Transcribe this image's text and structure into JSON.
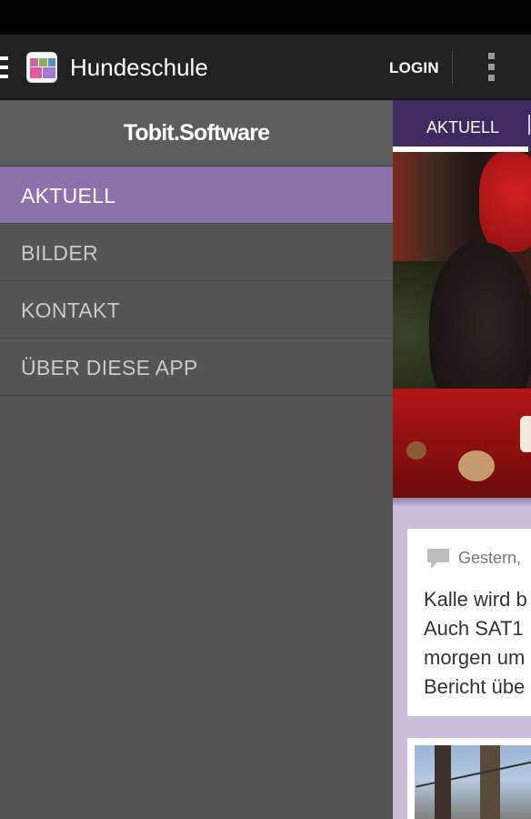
{
  "actionbar": {
    "title": "Hundeschule",
    "login_label": "LOGIN",
    "menu_icon": "hamburger-icon",
    "overflow_icon": "overflow-menu-icon"
  },
  "drawer": {
    "brand": "Tobit.Software",
    "items": [
      {
        "label": "AKTUELL",
        "active": true
      },
      {
        "label": "BILDER",
        "active": false
      },
      {
        "label": "KONTAKT",
        "active": false
      },
      {
        "label": "ÜBER DIESE APP",
        "active": false
      }
    ]
  },
  "content": {
    "tab_label": "AKTUELL",
    "post": {
      "date": "Gestern,",
      "lines": [
        "Kalle wird b",
        "Auch SAT1",
        "morgen um",
        "Bericht übe"
      ],
      "icon": "comment-icon"
    }
  },
  "colors": {
    "accent": "#8a72ad",
    "tabbar": "#3d2a63",
    "content_bg": "#c9bedb",
    "drawer_bg": "#555555",
    "actionbar_bg": "#222222"
  }
}
